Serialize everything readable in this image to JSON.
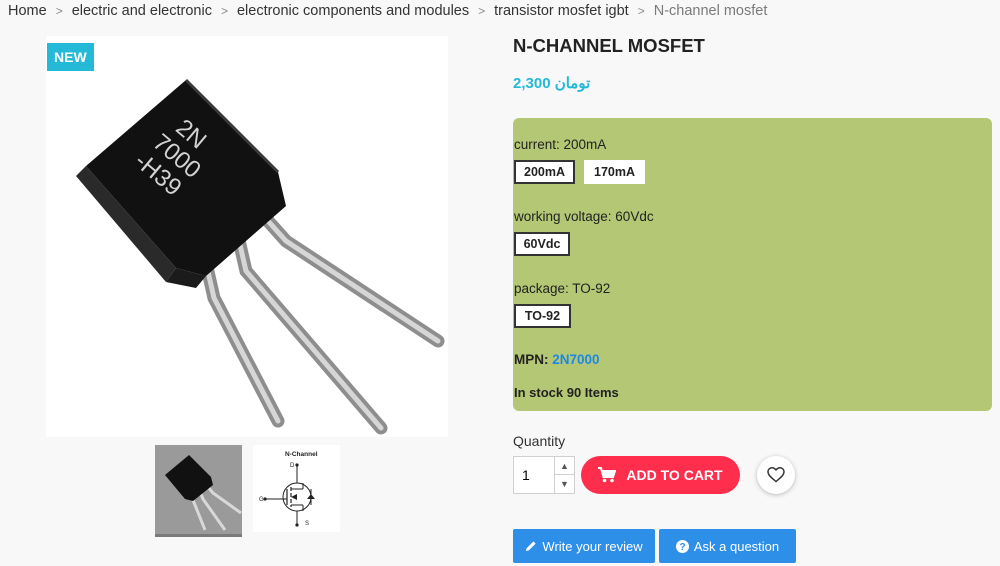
{
  "breadcrumb": {
    "items": [
      "Home",
      "electric and electronic",
      "electronic components and modules",
      "transistor mosfet igbt"
    ],
    "current": "N-channel mosfet",
    "separator": ">"
  },
  "gallery": {
    "badge": "NEW",
    "chip_text": [
      "2N",
      "7000",
      "-H39"
    ],
    "schematic": {
      "title": "N-Channel",
      "pins": [
        "D",
        "G",
        "S"
      ]
    }
  },
  "product": {
    "title": "N-CHANNEL MOSFET",
    "price": "2,300 تومان",
    "options": {
      "current": {
        "label": "current: 200mA",
        "values": [
          "200mA",
          "170mA"
        ],
        "selected": "200mA"
      },
      "voltage": {
        "label": "working voltage: 60Vdc",
        "values": [
          "60Vdc"
        ],
        "selected": "60Vdc"
      },
      "package": {
        "label": "package: TO-92",
        "values": [
          "TO-92"
        ],
        "selected": "TO-92"
      }
    },
    "mpn_label": "MPN:",
    "mpn_value": "2N7000",
    "stock": "In stock 90 Items"
  },
  "cart": {
    "quantity_label": "Quantity",
    "quantity_value": "1",
    "add_label": "ADD TO CART"
  },
  "actions": {
    "review_label": "Write your review",
    "ask_label": "Ask a question"
  },
  "colors": {
    "accent": "#24b9d7",
    "cart": "#ff2e4d",
    "options_bg": "#b3c774",
    "action_blue": "#2d8fe8",
    "mpn": "#1e88e5"
  },
  "icons": [
    "cart-icon",
    "heart-icon",
    "pencil-icon",
    "question-icon",
    "chevron-up-icon",
    "chevron-down-icon"
  ]
}
